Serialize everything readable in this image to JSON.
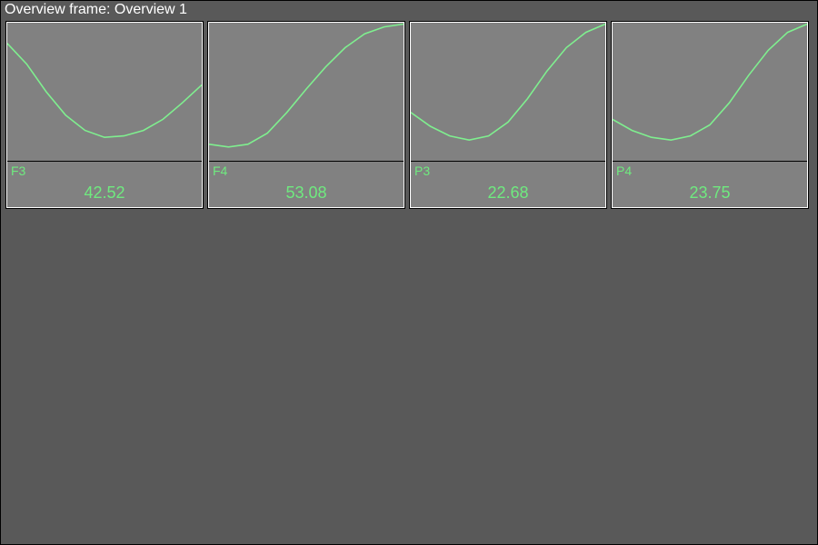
{
  "header": {
    "title": "Overview frame: Overview 1"
  },
  "colors": {
    "line": "#7fef8f",
    "panel_bg": "#818181",
    "frame_bg": "#595959",
    "text": "#ffffff"
  },
  "channels": [
    {
      "name": "F3",
      "value": "42.52"
    },
    {
      "name": "F4",
      "value": "53.08"
    },
    {
      "name": "P3",
      "value": "22.68"
    },
    {
      "name": "P4",
      "value": "23.75"
    }
  ],
  "chart_data": [
    {
      "type": "line",
      "title": "F3",
      "x": [
        0,
        10,
        20,
        30,
        40,
        50,
        60,
        70,
        80,
        90,
        100
      ],
      "values": [
        85,
        70,
        50,
        33,
        22,
        17,
        18,
        22,
        30,
        42,
        55
      ],
      "ylim": [
        0,
        100
      ]
    },
    {
      "type": "line",
      "title": "F4",
      "x": [
        0,
        10,
        20,
        30,
        40,
        50,
        60,
        70,
        80,
        90,
        100
      ],
      "values": [
        12,
        10,
        12,
        20,
        35,
        52,
        68,
        82,
        92,
        97,
        99
      ],
      "ylim": [
        0,
        100
      ]
    },
    {
      "type": "line",
      "title": "P3",
      "x": [
        0,
        10,
        20,
        30,
        40,
        50,
        60,
        70,
        80,
        90,
        100
      ],
      "values": [
        35,
        25,
        18,
        15,
        18,
        28,
        45,
        65,
        82,
        93,
        99
      ],
      "ylim": [
        0,
        100
      ]
    },
    {
      "type": "line",
      "title": "P4",
      "x": [
        0,
        10,
        20,
        30,
        40,
        50,
        60,
        70,
        80,
        90,
        100
      ],
      "values": [
        30,
        22,
        17,
        15,
        18,
        26,
        42,
        62,
        80,
        93,
        99
      ],
      "ylim": [
        0,
        100
      ]
    }
  ]
}
